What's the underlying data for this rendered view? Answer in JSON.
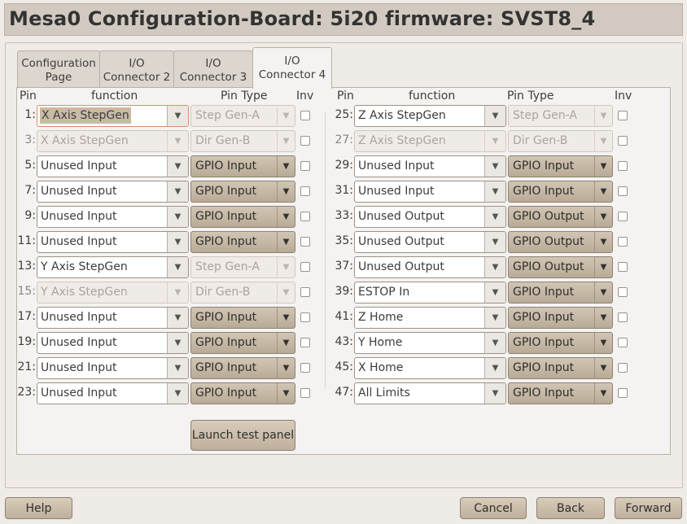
{
  "window": {
    "title": "Mesa0 Configuration-Board: 5i20 firmware: SVST8_4"
  },
  "tabs": [
    {
      "label_line1": "Configuration",
      "label_line2": "Page"
    },
    {
      "label_line1": "I/O",
      "label_line2": "Connector 2"
    },
    {
      "label_line1": "I/O",
      "label_line2": "Connector 3"
    },
    {
      "label_line1": "I/O",
      "label_line2": "Connector 4"
    }
  ],
  "active_tab": "I/O Connector 4",
  "headers": {
    "pin": "Pin",
    "function": "function",
    "pin_type": "Pin Type",
    "inv": "Inv"
  },
  "left_rows": [
    {
      "pin": "1:",
      "function": "X Axis StepGen",
      "type": "Step Gen-A"
    },
    {
      "pin": "3:",
      "function": "X Axis StepGen",
      "type": "Dir Gen-B"
    },
    {
      "pin": "5:",
      "function": "Unused Input",
      "type": "GPIO Input"
    },
    {
      "pin": "7:",
      "function": "Unused Input",
      "type": "GPIO Input"
    },
    {
      "pin": "9:",
      "function": "Unused Input",
      "type": "GPIO Input"
    },
    {
      "pin": "11:",
      "function": "Unused Input",
      "type": "GPIO Input"
    },
    {
      "pin": "13:",
      "function": "Y Axis StepGen",
      "type": "Step Gen-A"
    },
    {
      "pin": "15:",
      "function": "Y Axis StepGen",
      "type": "Dir Gen-B"
    },
    {
      "pin": "17:",
      "function": "Unused Input",
      "type": "GPIO Input"
    },
    {
      "pin": "19:",
      "function": "Unused Input",
      "type": "GPIO Input"
    },
    {
      "pin": "21:",
      "function": "Unused Input",
      "type": "GPIO Input"
    },
    {
      "pin": "23:",
      "function": "Unused Input",
      "type": "GPIO Input"
    }
  ],
  "right_rows": [
    {
      "pin": "25:",
      "function": "Z Axis StepGen",
      "type": "Step Gen-A"
    },
    {
      "pin": "27:",
      "function": "Z Axis StepGen",
      "type": "Dir Gen-B"
    },
    {
      "pin": "29:",
      "function": "Unused Input",
      "type": "GPIO Input"
    },
    {
      "pin": "31:",
      "function": "Unused Input",
      "type": "GPIO Input"
    },
    {
      "pin": "33:",
      "function": "Unused Output",
      "type": "GPIO Output"
    },
    {
      "pin": "35:",
      "function": "Unused Output",
      "type": "GPIO Output"
    },
    {
      "pin": "37:",
      "function": "Unused Output",
      "type": "GPIO Output"
    },
    {
      "pin": "39:",
      "function": "ESTOP In",
      "type": "GPIO Input"
    },
    {
      "pin": "41:",
      "function": "Z Home",
      "type": "GPIO Input"
    },
    {
      "pin": "43:",
      "function": "Y Home",
      "type": "GPIO Input"
    },
    {
      "pin": "45:",
      "function": "X Home",
      "type": "GPIO Input"
    },
    {
      "pin": "47:",
      "function": "All Limits",
      "type": "GPIO Input"
    }
  ],
  "launch_button": "Launch test panel",
  "footer": {
    "help": "Help",
    "cancel": "Cancel",
    "back": "Back",
    "forward": "Forward"
  },
  "icons": {
    "dropdown": "chevron-down-icon"
  },
  "colors": {
    "header_bg": "#d2cac1",
    "button_top": "#d8ccba",
    "button_bottom": "#bfb09b"
  }
}
